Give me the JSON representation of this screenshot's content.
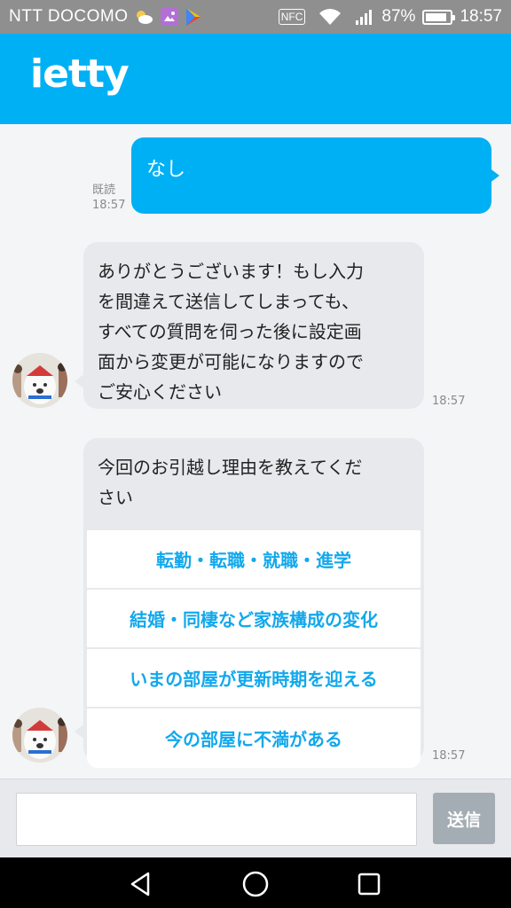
{
  "status_bar": {
    "carrier": "NTT DOCOMO",
    "nfc": "NFC",
    "battery_percent": "87%",
    "battery_level": 0.87,
    "time": "18:57",
    "icons": [
      "weather-icon",
      "gallery-notification-icon",
      "play-store-icon",
      "wifi-icon",
      "signal-icon",
      "battery-icon"
    ]
  },
  "header": {
    "logo": "ietty"
  },
  "messages": {
    "outgoing": {
      "text": "なし",
      "read_label": "既読",
      "time": "18:57"
    },
    "incoming_1": {
      "lines": [
        "ありがとうございます！もし入力",
        "を間違えて送信してしまっても、",
        "すべての質問を伺った後に設定画",
        "面から変更が可能になりますので",
        "ご安心ください"
      ],
      "time": "18:57"
    },
    "incoming_2": {
      "question_lines": [
        "今回のお引越し理由を教えてくだ",
        "さい"
      ],
      "options": [
        "転勤・転職・就職・進学",
        "結婚・同棲など家族構成の変化",
        "いまの部屋が更新時期を迎える",
        "今の部屋に不満がある"
      ],
      "time": "18:57"
    }
  },
  "input_bar": {
    "value": "",
    "send_label": "送信"
  },
  "colors": {
    "brand": "#00b0f5",
    "option_text": "#12a8ec",
    "bubble_gray": "#e7e9ec",
    "send_button": "#a4acb4"
  }
}
